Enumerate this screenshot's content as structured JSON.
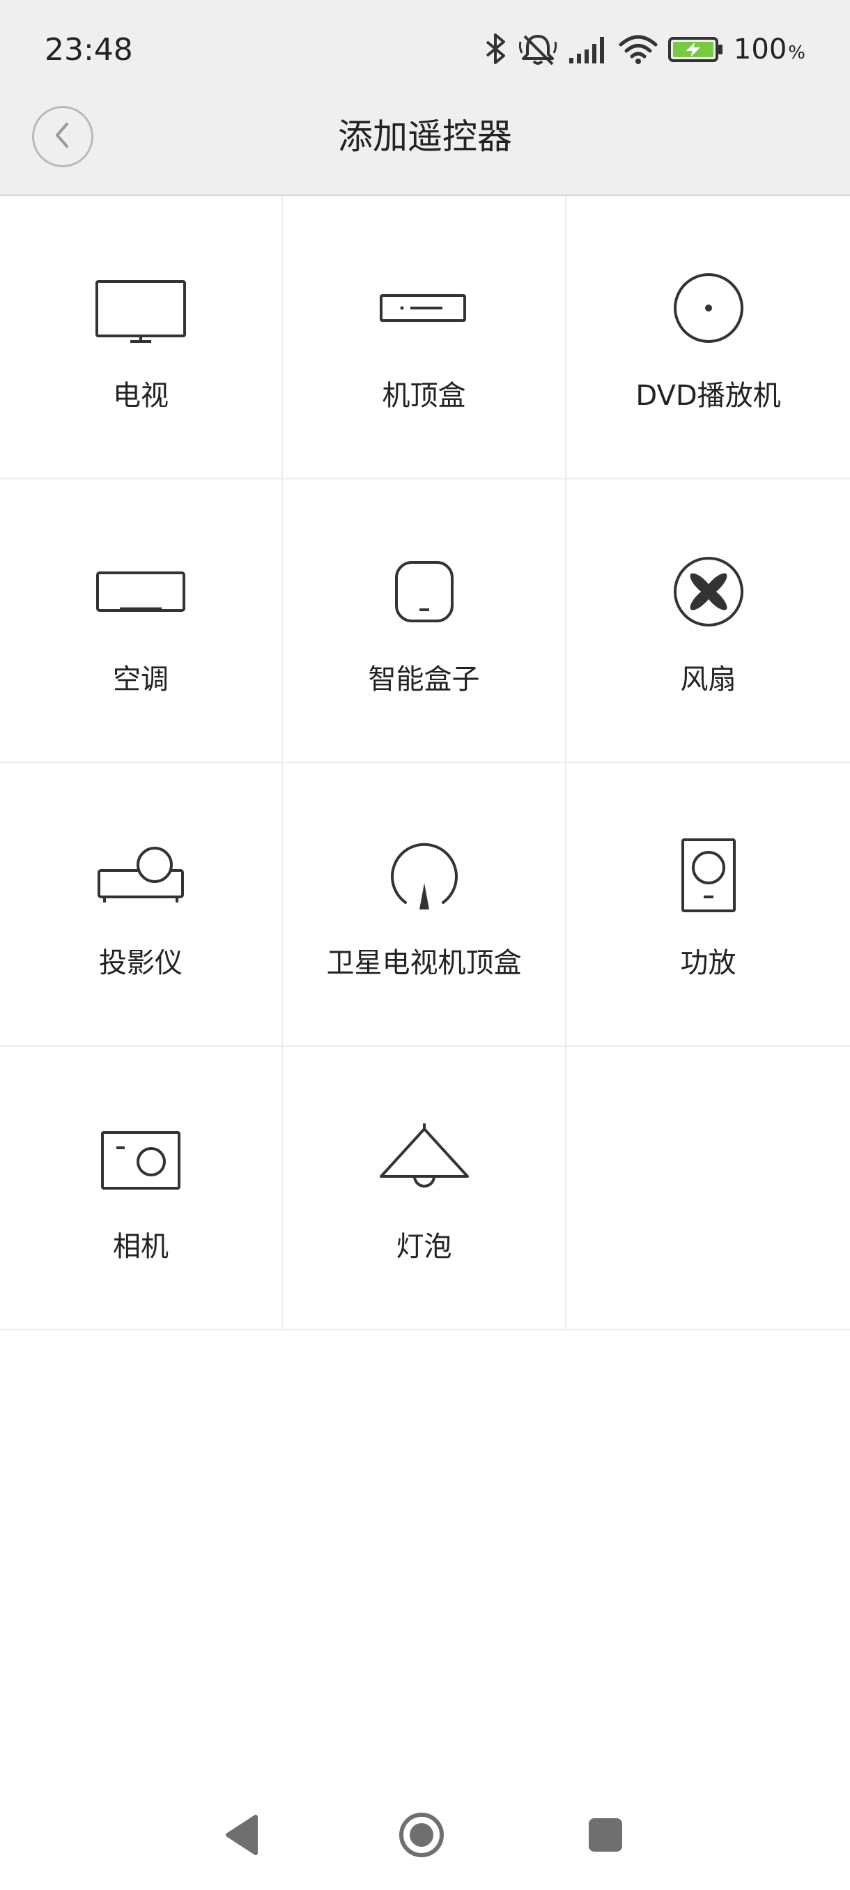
{
  "status_bar": {
    "time": "23:48",
    "battery_percent": "100",
    "battery_percent_sign": "%",
    "icons": [
      "bluetooth-icon",
      "mute-icon",
      "signal-icon",
      "wifi-icon",
      "battery-charging-icon"
    ]
  },
  "header": {
    "title": "添加遥控器",
    "back_icon": "back-arrow-icon"
  },
  "devices": [
    {
      "label": "电视",
      "icon": "tv-icon"
    },
    {
      "label": "机顶盒",
      "icon": "set-top-box-icon"
    },
    {
      "label": "DVD播放机",
      "icon": "dvd-icon"
    },
    {
      "label": "空调",
      "icon": "air-conditioner-icon"
    },
    {
      "label": "智能盒子",
      "icon": "smart-box-icon"
    },
    {
      "label": "风扇",
      "icon": "fan-icon"
    },
    {
      "label": "投影仪",
      "icon": "projector-icon"
    },
    {
      "label": "卫星电视机顶盒",
      "icon": "satellite-icon"
    },
    {
      "label": "功放",
      "icon": "amplifier-icon"
    },
    {
      "label": "相机",
      "icon": "camera-icon"
    },
    {
      "label": "灯泡",
      "icon": "lamp-icon"
    }
  ],
  "nav_bar": {
    "buttons": [
      "back-triangle-icon",
      "home-circle-icon",
      "recents-square-icon"
    ]
  },
  "colors": {
    "header_bg": "#efefef",
    "text": "#222222",
    "icon_stroke": "#333333",
    "divider": "#ececec",
    "battery_fill": "#7ac943"
  }
}
